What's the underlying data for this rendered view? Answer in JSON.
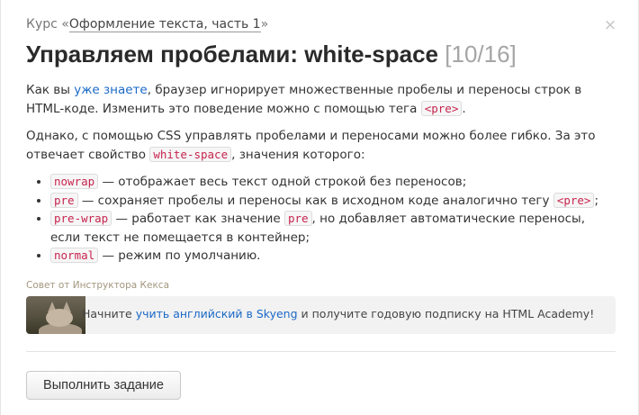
{
  "header": {
    "course_prefix": "Курс «",
    "course_name": "Оформление текста, часть 1",
    "course_suffix": "»",
    "close_glyph": "×",
    "title": "Управляем пробелами: white-space",
    "counter": "[10/16]"
  },
  "content": {
    "p1_a": "Как вы ",
    "p1_link": "уже знаете",
    "p1_b": ", браузер игнорирует множественные пробелы и переносы строк в HTML-коде. Изменить это поведение можно с помощью тега ",
    "p1_code": "<pre>",
    "p1_c": ".",
    "p2_a": "Однако, с помощью CSS управлять пробелами и переносами можно более гибко. За это отвечает свойство ",
    "p2_code": "white-space",
    "p2_b": ", значения которого:",
    "items": [
      {
        "code": "nowrap",
        "text": " — отображает весь текст одной строкой без переносов;"
      },
      {
        "code": "pre",
        "text": " — сохраняет пробелы и переносы как в исходном коде аналогично тегу ",
        "code2": "<pre>",
        "text2": ";"
      },
      {
        "code": "pre-wrap",
        "text": " — работает как значение ",
        "code2": "pre",
        "text2": ", но добавляет автоматические переносы, если текст не помещается в контейнер;"
      },
      {
        "code": "normal",
        "text": " — режим по умолчанию."
      }
    ]
  },
  "tip": {
    "label": "Совет от Инструктора Кекса",
    "text_a": "Начните ",
    "link": "учить английский в Skyeng",
    "text_b": " и получите годовую подписку на HTML Academy!"
  },
  "footer": {
    "submit_label": "Выполнить задание"
  }
}
